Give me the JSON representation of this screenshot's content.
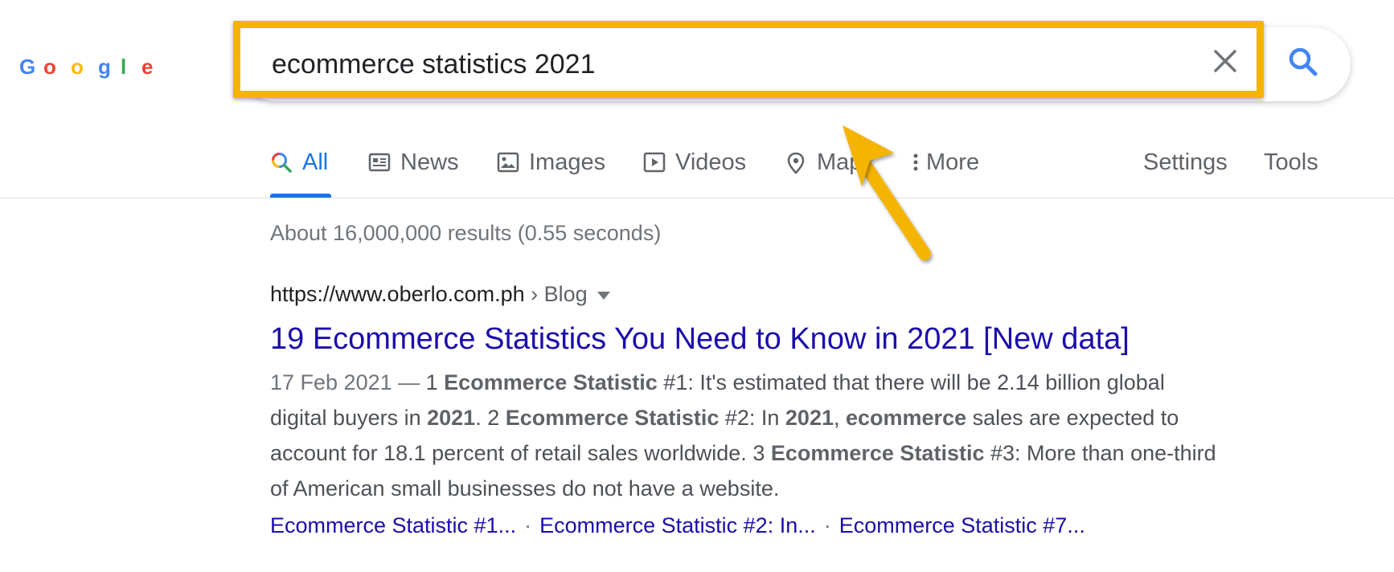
{
  "logo": {
    "letters": [
      "G",
      "o",
      "o",
      "g",
      "l",
      "e"
    ]
  },
  "search": {
    "query": "ecommerce statistics 2021"
  },
  "tabs": [
    {
      "label": "All",
      "icon": "search-icon",
      "active": true
    },
    {
      "label": "News",
      "icon": "news-icon"
    },
    {
      "label": "Images",
      "icon": "image-icon"
    },
    {
      "label": "Videos",
      "icon": "video-icon"
    },
    {
      "label": "Maps",
      "icon": "map-pin-icon"
    },
    {
      "label": "More",
      "icon": "more-vert-icon"
    }
  ],
  "tools": {
    "settings": "Settings",
    "tools": "Tools"
  },
  "stats": "About 16,000,000 results (0.55 seconds)",
  "result": {
    "url": "https://www.oberlo.com.ph",
    "breadcrumb": " › Blog",
    "title": "19 Ecommerce Statistics You Need to Know in 2021 [New data]",
    "date": "17 Feb 2021 — ",
    "snippet": [
      {
        "t": "1 ",
        "b": false
      },
      {
        "t": "Ecommerce Statistic",
        "b": true
      },
      {
        "t": " #1: It's estimated that there will be 2.14 billion global digital buyers in ",
        "b": false
      },
      {
        "t": "2021",
        "b": true
      },
      {
        "t": ". 2 ",
        "b": false
      },
      {
        "t": "Ecommerce Statistic",
        "b": true
      },
      {
        "t": " #2: In ",
        "b": false
      },
      {
        "t": "2021",
        "b": true
      },
      {
        "t": ", ",
        "b": false
      },
      {
        "t": "ecommerce",
        "b": true
      },
      {
        "t": " sales are expected to account for 18.1 percent of retail sales worldwide. 3 ",
        "b": false
      },
      {
        "t": "Ecommerce Statistic",
        "b": true
      },
      {
        "t": " #3: More than one-third of American small businesses do not have a website.",
        "b": false
      }
    ],
    "sitelinks": [
      "Ecommerce Statistic #1...",
      "Ecommerce Statistic #2: In...",
      "Ecommerce Statistic #7..."
    ],
    "sitelink_separator": "·"
  },
  "colors": {
    "highlight": "#f5b400",
    "link": "#1a0dab",
    "accent": "#1a73e8"
  }
}
